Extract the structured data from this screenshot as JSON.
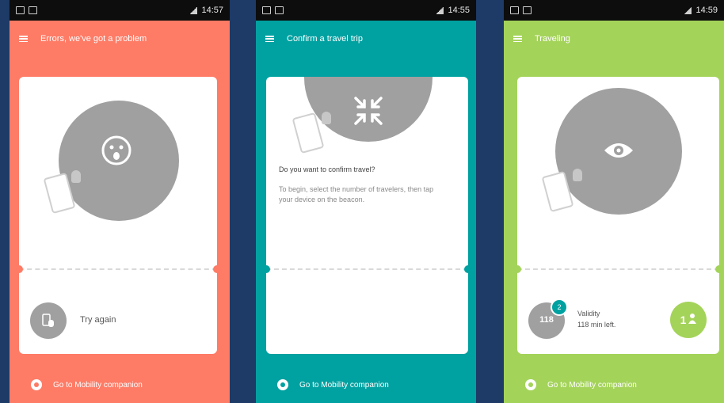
{
  "colors": {
    "background": "#1e3a66",
    "error": "#fe7b66",
    "confirm": "#00a1a1",
    "traveling": "#a4d35a",
    "circle": "#a0a0a0"
  },
  "screens": [
    {
      "status_time": "14:57",
      "title": "Errors, we've got a problem",
      "circle_icon": "sad-face-icon",
      "action_label": "Try again",
      "footer_label": "Go to Mobility companion"
    },
    {
      "status_time": "14:55",
      "title": "Confirm a travel trip",
      "circle_icon": "contract-arrows-icon",
      "question": "Do you want to confirm travel?",
      "instructions": "To begin, select the number of travelers, then tap your device on the beacon.",
      "footer_label": "Go to Mobility companion"
    },
    {
      "status_time": "14:59",
      "title": "Traveling",
      "circle_icon": "eye-icon",
      "counter_badge": "2",
      "minutes_value": "118",
      "validity_label": "Validity",
      "validity_text": "118 min left.",
      "travelers_count": "1",
      "footer_label": "Go to Mobility companion"
    }
  ]
}
